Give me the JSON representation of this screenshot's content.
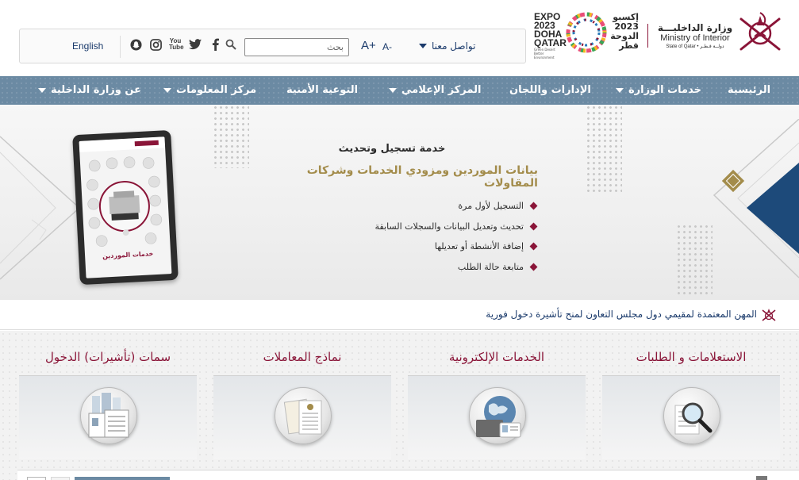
{
  "toolbar": {
    "language_link": "English",
    "social_icons": [
      "snapchat-icon",
      "instagram-icon",
      "youtube-icon",
      "twitter-icon",
      "facebook-icon"
    ],
    "youtube_label": "You Tube",
    "search_placeholder": "بحث",
    "font_decrease": "A-",
    "font_increase": "A+",
    "contact_label": "تواصل معنا"
  },
  "expo": {
    "en_lines": [
      "EXPO",
      "2023",
      "DOHA",
      "QATAR"
    ],
    "sub": "Green Desert Better Environment",
    "ar_lines": [
      "إكسبو",
      "2023",
      "الدوحة",
      "قطر"
    ]
  },
  "ministry": {
    "name_ar": "وزارة الداخليـــة",
    "name_en": "Ministry of Interior",
    "state": "State of Qatar • دولــة قـطـر"
  },
  "nav": [
    {
      "label": "الرئيسية",
      "dropdown": false
    },
    {
      "label": "خدمات الوزارة",
      "dropdown": true
    },
    {
      "label": "الإدارات واللجان",
      "dropdown": false
    },
    {
      "label": "المركز الإعلامي",
      "dropdown": true
    },
    {
      "label": "التوعية الأمنية",
      "dropdown": false
    },
    {
      "label": "مركز المعلومات",
      "dropdown": true
    },
    {
      "label": "عن وزارة الداخلية",
      "dropdown": true
    }
  ],
  "banner": {
    "title": "خدمة تسجيل وتحديث",
    "subtitle": "بيانات الموردين ومزودي الخدمات وشركات المقاولات",
    "bullets": [
      "التسجيل لأول مرة",
      "تحديث وتعديل البيانات والسجلات السابقة",
      "إضافة الأنشطة أو تعديلها",
      "متابعة حالة الطلب"
    ],
    "tablet_caption": "خدمات الموردين"
  },
  "ticker": {
    "text": "المهن المعتمدة لمقيمي دول مجلس التعاون لمنح تأشيرة دخول فورية"
  },
  "cards": [
    {
      "title": "الاستعلامات و الطلبات",
      "icon": "magnifier-icon"
    },
    {
      "title": "الخدمات الإلكترونية",
      "icon": "globe-id-icon"
    },
    {
      "title": "نماذج المعاملات",
      "icon": "forms-icon"
    },
    {
      "title": "سمات (تأشيرات) الدخول",
      "icon": "visa-icon"
    }
  ],
  "colors": {
    "nav": "#6b8aa3",
    "maroon": "#8a1538",
    "gold": "#a38c4b",
    "navy": "#1a3a6b"
  }
}
